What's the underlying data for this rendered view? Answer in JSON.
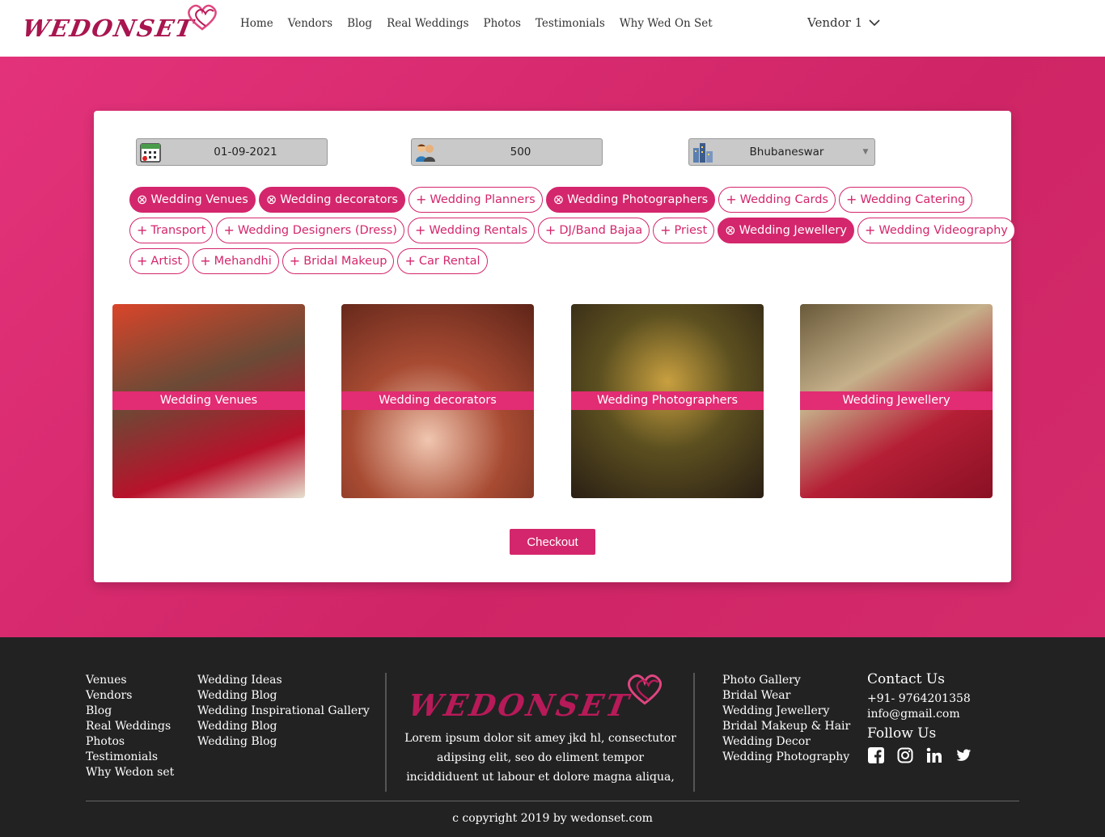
{
  "header": {
    "logo_text": "WEDONSET",
    "nav": [
      "Home",
      "Vendors",
      "Blog",
      "Real Weddings",
      "Photos",
      "Testimonials",
      "Why Wed On Set"
    ],
    "user_menu": "Vendor 1"
  },
  "search": {
    "date": "01-09-2021",
    "guests": "500",
    "city": "Bhubaneswar"
  },
  "categories": {
    "row1": [
      {
        "label": "Wedding Venues",
        "selected": true
      },
      {
        "label": "Wedding decorators",
        "selected": true
      },
      {
        "label": "Wedding Planners",
        "selected": false
      },
      {
        "label": "Wedding Photographers",
        "selected": true
      },
      {
        "label": "Wedding Cards",
        "selected": false
      },
      {
        "label": "Wedding Catering",
        "selected": false
      }
    ],
    "row2": [
      {
        "label": "Transport",
        "selected": false
      },
      {
        "label": "Wedding Designers (Dress)",
        "selected": false
      },
      {
        "label": "Wedding Rentals",
        "selected": false
      },
      {
        "label": "DJ/Band Bajaa",
        "selected": false
      },
      {
        "label": "Priest",
        "selected": false
      },
      {
        "label": "Wedding Jewellery",
        "selected": true
      },
      {
        "label": "Wedding Videography",
        "selected": false
      }
    ],
    "row3": [
      {
        "label": "Artist",
        "selected": false
      },
      {
        "label": "Mehandhi",
        "selected": false
      },
      {
        "label": "Bridal Makeup",
        "selected": false
      },
      {
        "label": "Car Rental",
        "selected": false
      }
    ]
  },
  "selected_tiles": [
    "Wedding Venues",
    "Wedding decorators",
    "Wedding Photographers",
    "Wedding Jewellery"
  ],
  "checkout_label": "Checkout",
  "footer": {
    "col1": [
      "Venues",
      "Vendors",
      "Blog",
      "Real Weddings",
      "Photos",
      "Testimonials",
      "Why Wedon set"
    ],
    "col2": [
      "Wedding Ideas",
      "Wedding Blog",
      "Wedding Inspirational Gallery",
      "Wedding Blog",
      "Wedding Blog"
    ],
    "logo_text": "WEDONSET",
    "about": "Lorem ipsum dolor sit amey jkd hl, consectutor adipsing elit, seo do eliment tempor inciddiduent ut labour et dolore magna aliqua,",
    "col3": [
      "Photo Gallery",
      "Bridal Wear",
      "Wedding Jewellery",
      "Bridal Makeup & Hair",
      "Wedding Decor",
      "Wedding Photography"
    ],
    "contact_heading": "Contact Us",
    "phone": "+91- 9764201358",
    "email": "info@gmail.com",
    "follow_heading": "Follow Us",
    "copyright": "c copyright 2019 by wedonset.com"
  },
  "colors": {
    "brand": "#d4266c",
    "footer_bg": "#222223"
  }
}
